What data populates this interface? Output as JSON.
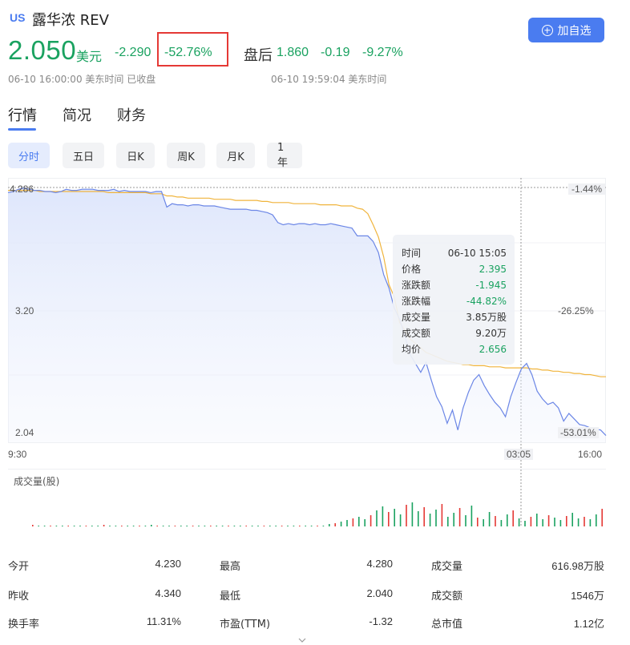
{
  "header": {
    "market_tag": "US",
    "name": "露华浓 REV",
    "price": "2.050",
    "currency": "美元",
    "change": "-2.290",
    "change_pct": "-52.76%",
    "afterhours_label": "盘后",
    "afterhours_price": "1.860",
    "afterhours_change": "-0.19",
    "afterhours_pct": "-9.27%",
    "close_time": "06-10 16:00:00 美东时间 已收盘",
    "afterhours_time": "06-10 19:59:04 美东时间",
    "add_button": "加自选"
  },
  "tabs": [
    {
      "label": "行情",
      "active": true
    },
    {
      "label": "简况",
      "active": false
    },
    {
      "label": "财务",
      "active": false
    }
  ],
  "ranges": [
    {
      "label": "分时",
      "active": true
    },
    {
      "label": "五日",
      "active": false
    },
    {
      "label": "日K",
      "active": false
    },
    {
      "label": "周K",
      "active": false
    },
    {
      "label": "月K",
      "active": false
    },
    {
      "label": "1年",
      "active": false
    }
  ],
  "chart_data": {
    "type": "line",
    "y_left_labels": [
      "4.286",
      "3.20",
      "2.04"
    ],
    "y_right_labels": [
      "-1.44%",
      "-26.25%",
      "-53.01%"
    ],
    "x_labels": [
      "9:30",
      "03:05",
      "16:00"
    ],
    "ylim": [
      2.04,
      4.286
    ],
    "series": [
      {
        "name": "价格",
        "color": "#6b86e6",
        "values": [
          4.24,
          4.25,
          4.27,
          4.28,
          4.27,
          4.26,
          4.26,
          4.25,
          4.25,
          4.24,
          4.25,
          4.27,
          4.26,
          4.26,
          4.27,
          4.27,
          4.27,
          4.26,
          4.26,
          4.26,
          4.27,
          4.25,
          4.26,
          4.25,
          4.25,
          4.25,
          4.25,
          4.24,
          4.25,
          4.25,
          4.11,
          4.14,
          4.13,
          4.13,
          4.12,
          4.13,
          4.13,
          4.12,
          4.12,
          4.12,
          4.11,
          4.1,
          4.09,
          4.09,
          4.09,
          4.09,
          4.08,
          4.08,
          4.07,
          4.06,
          4.04,
          3.97,
          3.95,
          3.96,
          3.95,
          3.96,
          3.96,
          3.95,
          3.96,
          3.95,
          3.95,
          3.96,
          3.95,
          3.94,
          3.93,
          3.92,
          3.85,
          3.85,
          3.85,
          3.8,
          3.7,
          3.5,
          3.38,
          3.2,
          3.1,
          2.95,
          2.78,
          2.7,
          2.62,
          2.71,
          2.55,
          2.4,
          2.31,
          2.16,
          2.28,
          2.1,
          2.3,
          2.44,
          2.55,
          2.6,
          2.5,
          2.42,
          2.35,
          2.3,
          2.22,
          2.4,
          2.53,
          2.65,
          2.7,
          2.6,
          2.45,
          2.38,
          2.33,
          2.35,
          2.3,
          2.18,
          2.25,
          2.2,
          2.15,
          2.14,
          2.12,
          2.11,
          2.1,
          2.05
        ]
      },
      {
        "name": "均价",
        "color": "#f0b43c",
        "values": [
          4.26,
          4.26,
          4.26,
          4.26,
          4.26,
          4.26,
          4.25,
          4.25,
          4.25,
          4.25,
          4.25,
          4.25,
          4.25,
          4.25,
          4.25,
          4.25,
          4.25,
          4.25,
          4.25,
          4.24,
          4.24,
          4.24,
          4.24,
          4.24,
          4.24,
          4.24,
          4.24,
          4.23,
          4.23,
          4.23,
          4.21,
          4.21,
          4.2,
          4.2,
          4.19,
          4.19,
          4.19,
          4.19,
          4.19,
          4.18,
          4.18,
          4.18,
          4.18,
          4.17,
          4.17,
          4.17,
          4.17,
          4.17,
          4.16,
          4.16,
          4.15,
          4.15,
          4.15,
          4.15,
          4.14,
          4.14,
          4.14,
          4.14,
          4.14,
          4.13,
          4.13,
          4.13,
          4.13,
          4.12,
          4.12,
          4.12,
          4.1,
          4.09,
          4.05,
          3.95,
          3.84,
          3.66,
          3.41,
          3.3,
          3.07,
          3.0,
          2.92,
          2.88,
          2.84,
          2.8,
          2.78,
          2.76,
          2.74,
          2.72,
          2.71,
          2.7,
          2.69,
          2.69,
          2.68,
          2.68,
          2.68,
          2.67,
          2.67,
          2.67,
          2.66,
          2.66,
          2.66,
          2.66,
          2.66,
          2.65,
          2.65,
          2.64,
          2.64,
          2.63,
          2.63,
          2.62,
          2.62,
          2.61,
          2.61,
          2.6,
          2.6,
          2.59,
          2.58,
          2.58
        ]
      }
    ],
    "volume_label": "成交量(股)"
  },
  "tooltip": {
    "rows": [
      {
        "label": "时间",
        "value": "06-10 15:05"
      },
      {
        "label": "价格",
        "value": "2.395"
      },
      {
        "label": "涨跌额",
        "value": "-1.945"
      },
      {
        "label": "涨跌幅",
        "value": "-44.82%"
      },
      {
        "label": "成交量",
        "value": "3.85万股"
      },
      {
        "label": "成交额",
        "value": "9.20万"
      },
      {
        "label": "均价",
        "value": "2.656"
      }
    ]
  },
  "stats": [
    [
      {
        "label": "今开",
        "value": "4.230",
        "color": "green"
      },
      {
        "label": "最高",
        "value": "4.280",
        "color": "green"
      },
      {
        "label": "成交量",
        "value": "616.98万股",
        "color": "plain"
      }
    ],
    [
      {
        "label": "昨收",
        "value": "4.340",
        "color": "plain"
      },
      {
        "label": "最低",
        "value": "2.040",
        "color": "green"
      },
      {
        "label": "成交额",
        "value": "1546万",
        "color": "plain"
      }
    ],
    [
      {
        "label": "换手率",
        "value": "11.31%",
        "color": "plain"
      },
      {
        "label": "市盈(TTM)",
        "value": "-1.32",
        "color": "plain"
      },
      {
        "label": "总市值",
        "value": "1.12亿",
        "color": "plain"
      }
    ]
  ],
  "colors": {
    "accent": "#4a7cf0",
    "down": "#1aa260",
    "up": "#e53935",
    "highlight_box": "#e53935"
  }
}
